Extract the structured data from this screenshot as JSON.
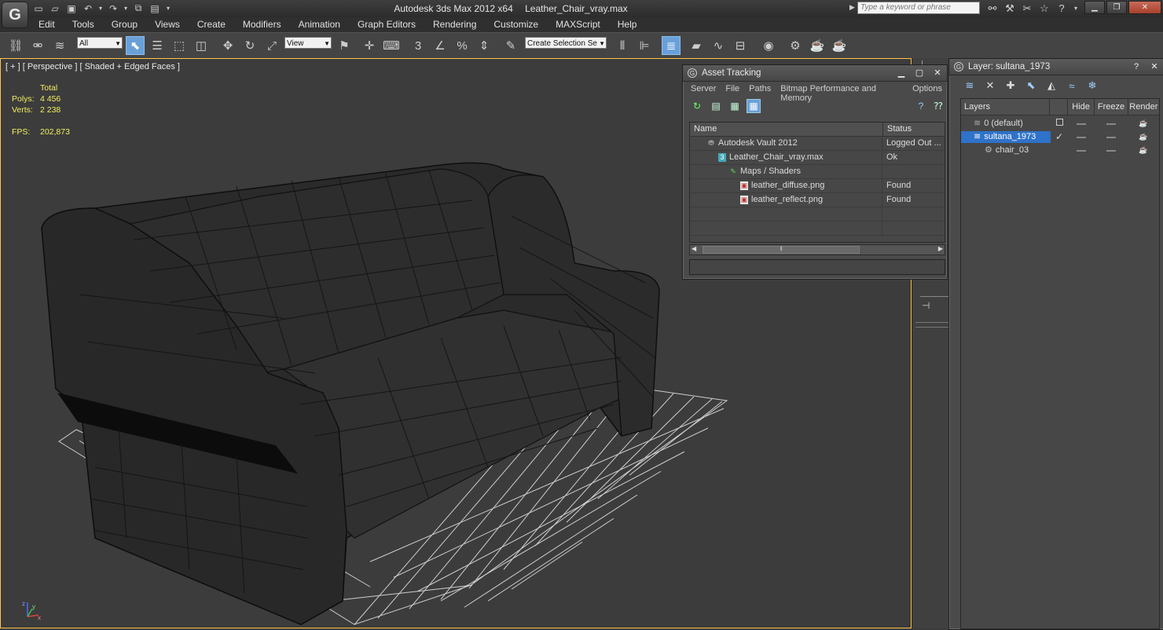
{
  "app": {
    "title": "Autodesk 3ds Max  2012 x64",
    "file_name": "Leather_Chair_vray.max",
    "search_placeholder": "Type a keyword or phrase"
  },
  "menu": [
    "Edit",
    "Tools",
    "Group",
    "Views",
    "Create",
    "Modifiers",
    "Animation",
    "Graph Editors",
    "Rendering",
    "Customize",
    "MAXScript",
    "Help"
  ],
  "toolbar": {
    "selection_filter": "All",
    "ref_coord_system": "View",
    "named_selection_placeholder": "Create Selection Se"
  },
  "viewport": {
    "label": "[ + ] [ Perspective ] [ Shaded + Edged Faces ]",
    "stats_header": "Total",
    "polys_label": "Polys:",
    "polys_value": "4 456",
    "verts_label": "Verts:",
    "verts_value": "2 238",
    "fps_label": "FPS:",
    "fps_value": "202,873",
    "axis_x": "x",
    "axis_y": "y",
    "axis_z": "z",
    "colors": {
      "stats_text": "#f2ef5e",
      "active_border": "#ffc54a",
      "background": "#3c3c3c"
    }
  },
  "asset_tracking": {
    "title": "Asset Tracking",
    "menu": [
      "Server",
      "File",
      "Paths",
      "Bitmap Performance and Memory",
      "Options"
    ],
    "columns": {
      "name": "Name",
      "status": "Status"
    },
    "rows": [
      {
        "name": "Autodesk Vault 2012",
        "status": "Logged Out ...",
        "icon": "vault-icon",
        "indent": 0
      },
      {
        "name": "Leather_Chair_vray.max",
        "status": "Ok",
        "icon": "max-file-icon",
        "indent": 1
      },
      {
        "name": "Maps / Shaders",
        "status": "",
        "icon": "maps-shaders-icon",
        "indent": 2
      },
      {
        "name": "leather_diffuse.png",
        "status": "Found",
        "icon": "bitmap-file-icon",
        "indent": 3
      },
      {
        "name": "leather_reflect.png",
        "status": "Found",
        "icon": "bitmap-file-icon",
        "indent": 3
      }
    ]
  },
  "layer_dialog": {
    "title": "Layer: sultana_1973",
    "columns": {
      "layers": "Layers",
      "hide": "Hide",
      "freeze": "Freeze",
      "render": "Render"
    },
    "rows": [
      {
        "name": "0 (default)",
        "selected": false,
        "indent": 0
      },
      {
        "name": "sultana_1973",
        "selected": true,
        "indent": 0
      },
      {
        "name": "chair_03",
        "selected": false,
        "indent": 1
      }
    ],
    "colors": {
      "selection": "#2f72c9"
    }
  }
}
